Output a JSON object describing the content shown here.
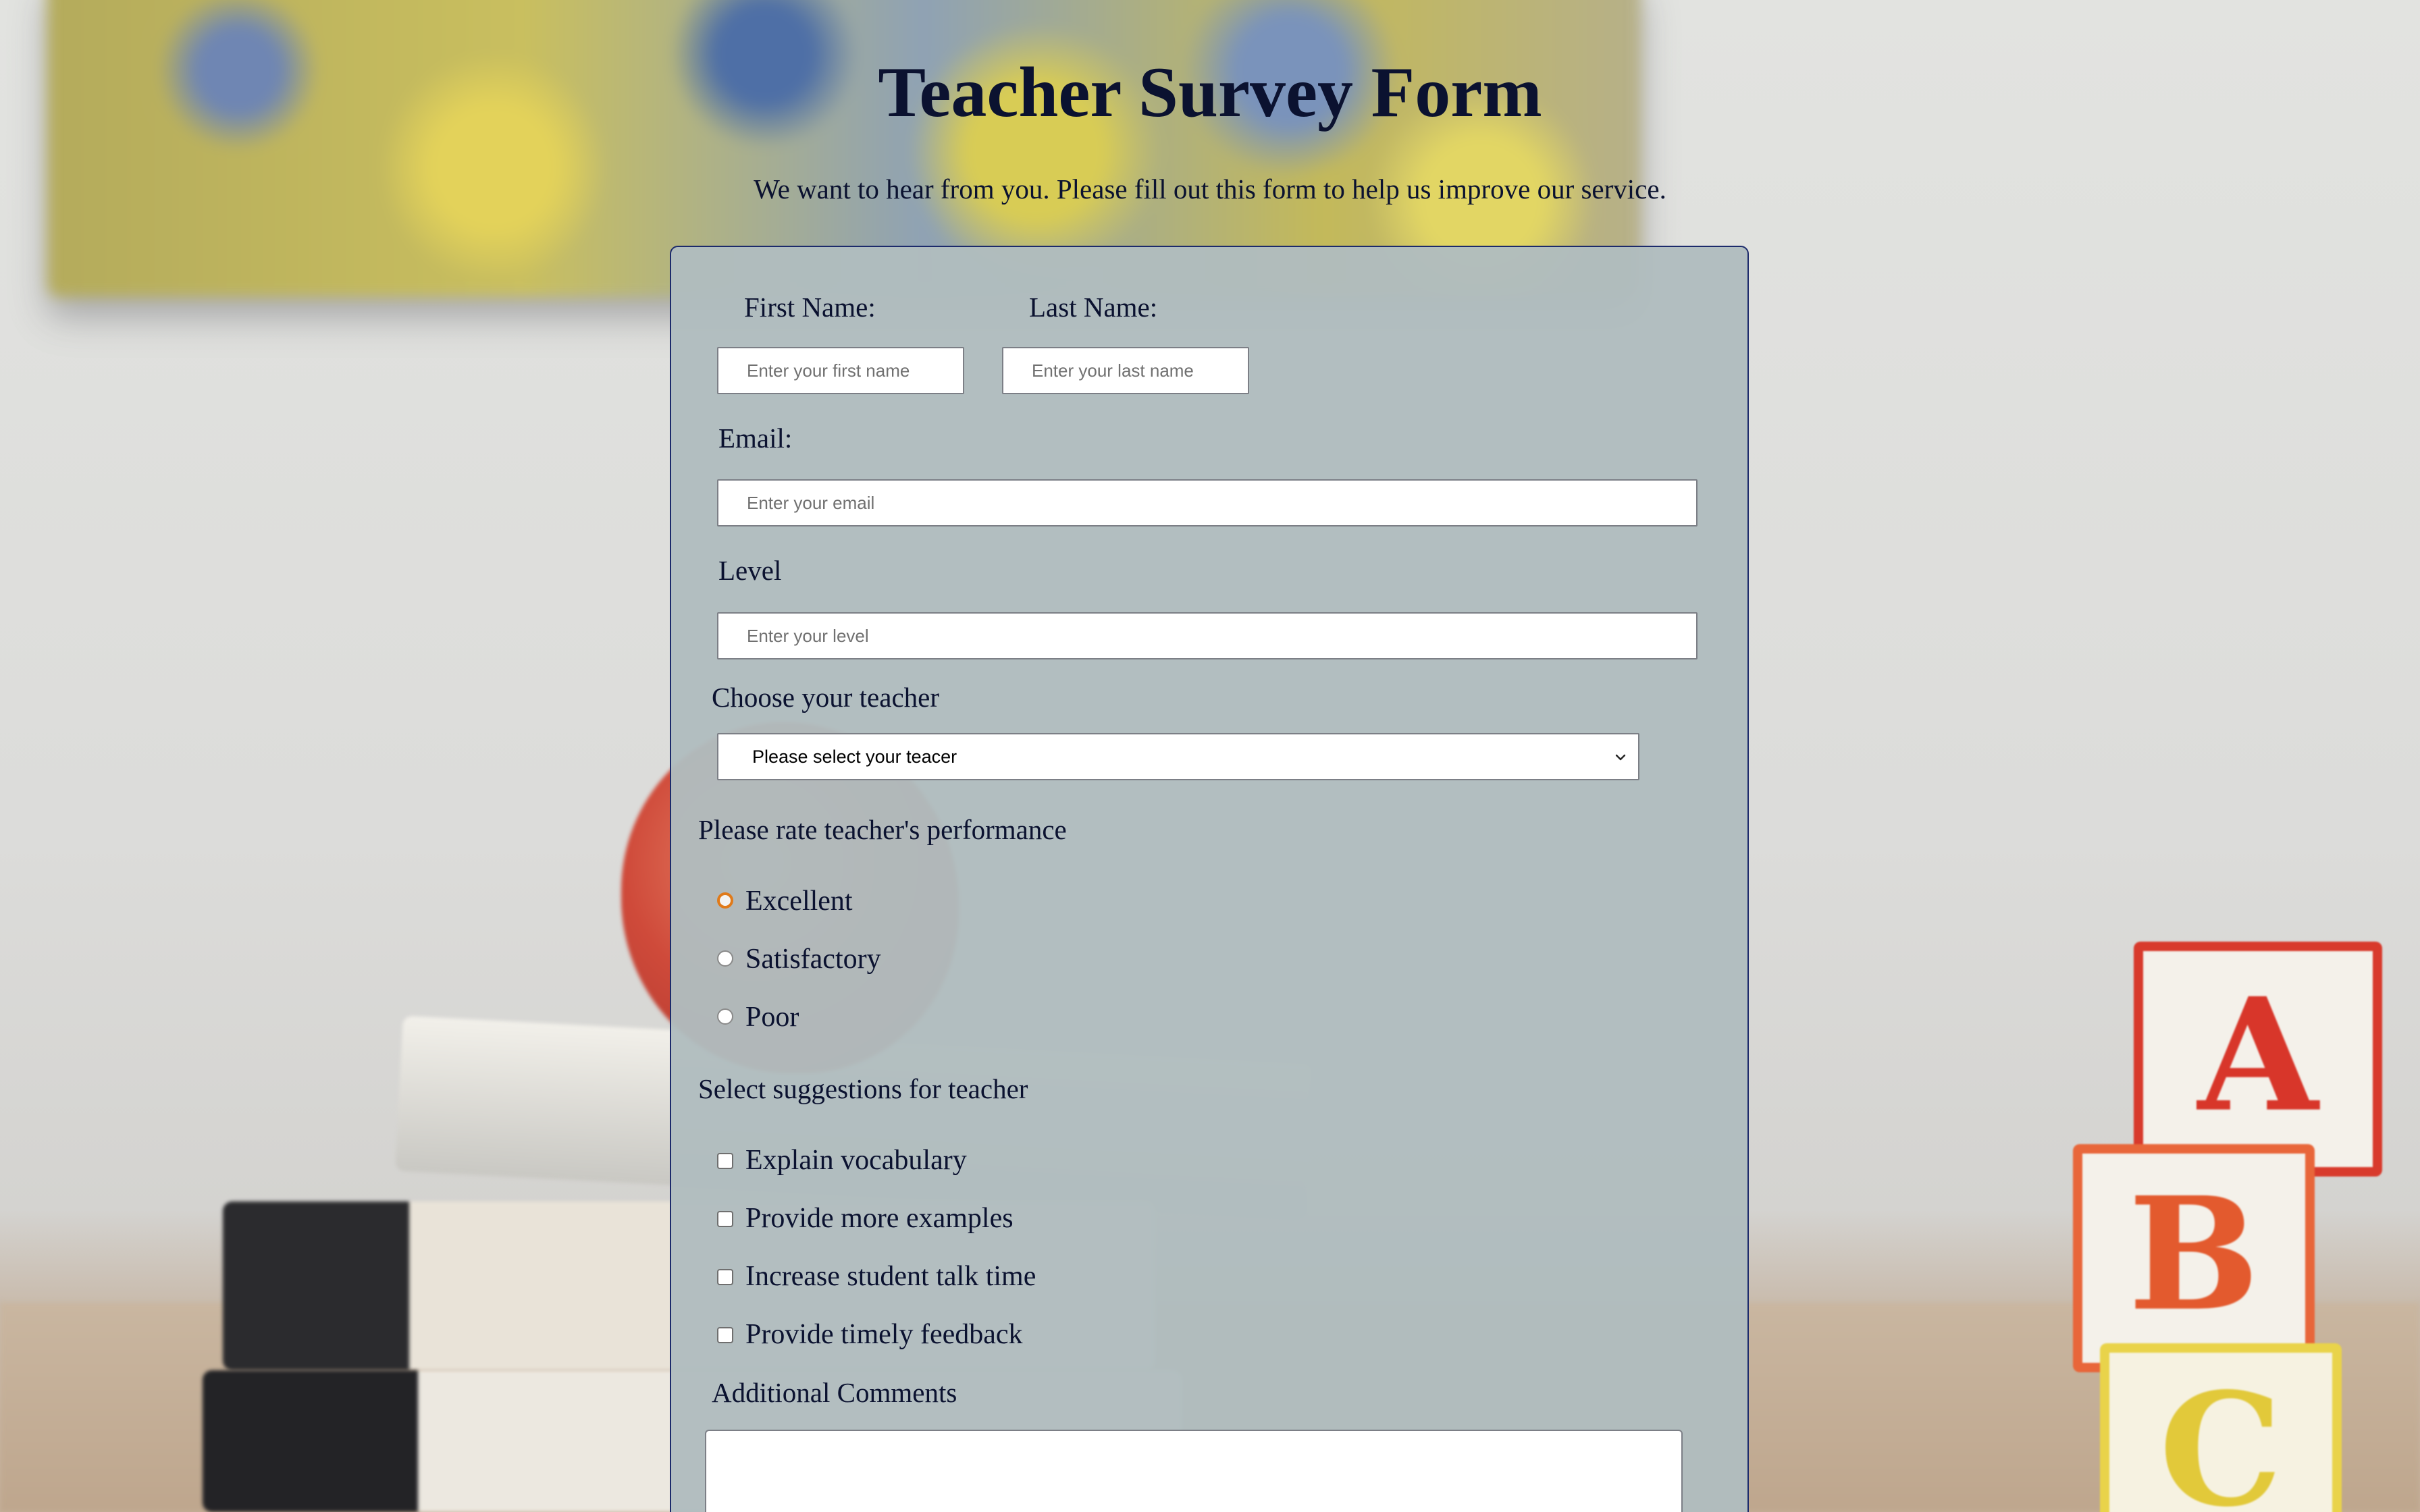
{
  "header": {
    "title": "Teacher Survey Form",
    "description": "We want to hear from you. Please fill out this form to help us improve our service."
  },
  "form": {
    "first_name": {
      "label": "First Name:",
      "placeholder": "Enter your first name",
      "value": ""
    },
    "last_name": {
      "label": "Last Name:",
      "placeholder": "Enter your last name",
      "value": ""
    },
    "email": {
      "label": "Email:",
      "placeholder": "Enter your email",
      "value": ""
    },
    "level": {
      "label": "Level",
      "placeholder": "Enter your level",
      "value": ""
    },
    "teacher": {
      "label": "Choose your teacher",
      "selected": "Please select your teacer"
    },
    "rating": {
      "label": "Please rate teacher's performance",
      "options": [
        "Excellent",
        "Satisfactory",
        "Poor"
      ],
      "focused": "Excellent",
      "selected": null
    },
    "suggestions": {
      "label": "Select suggestions for teacher",
      "options": [
        "Explain vocabulary",
        "Provide more examples",
        "Increase student talk time",
        "Provide timely feedback"
      ],
      "checked": []
    },
    "comments": {
      "label": "Additional Comments",
      "value": ""
    }
  },
  "colors": {
    "title_text": "#0b1230",
    "panel_border": "#1c2a6b",
    "panel_fill": "#b0bcbe",
    "focus_ring": "#e07a1a"
  },
  "icons": {
    "select_arrow": "chevron-down-icon"
  }
}
